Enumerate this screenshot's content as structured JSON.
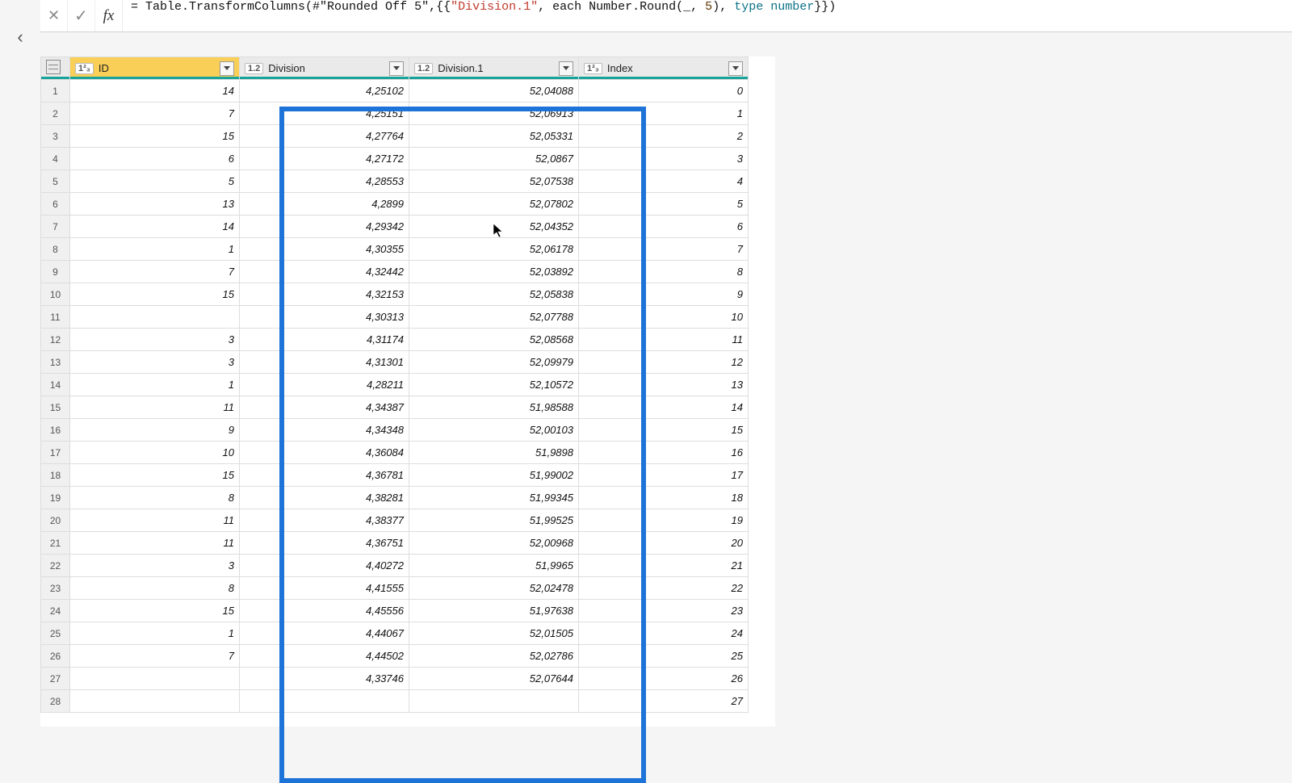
{
  "formula": {
    "prefix": "= Table.TransformColumns(#",
    "step_ref": "\"Rounded Off 5\"",
    "mid1": ",{{",
    "col_ref": "\"Division.1\"",
    "mid2": ", each Number.Round(_, ",
    "round_n": "5",
    "mid3": "), ",
    "type_kw": "type number",
    "suffix": "}})"
  },
  "columns": {
    "id": {
      "type": "1²₃",
      "label": "ID"
    },
    "div": {
      "type": "1.2",
      "label": "Division"
    },
    "div1": {
      "type": "1.2",
      "label": "Division.1"
    },
    "idx": {
      "type": "1²₃",
      "label": "Index"
    }
  },
  "rows": [
    {
      "n": "1",
      "id": "14",
      "div": "4,25102",
      "div1": "52,04088",
      "idx": "0"
    },
    {
      "n": "2",
      "id": "7",
      "div": "4,25151",
      "div1": "52,06913",
      "idx": "1"
    },
    {
      "n": "3",
      "id": "15",
      "div": "4,27764",
      "div1": "52,05331",
      "idx": "2"
    },
    {
      "n": "4",
      "id": "6",
      "div": "4,27172",
      "div1": "52,0867",
      "idx": "3"
    },
    {
      "n": "5",
      "id": "5",
      "div": "4,28553",
      "div1": "52,07538",
      "idx": "4"
    },
    {
      "n": "6",
      "id": "13",
      "div": "4,2899",
      "div1": "52,07802",
      "idx": "5"
    },
    {
      "n": "7",
      "id": "14",
      "div": "4,29342",
      "div1": "52,04352",
      "idx": "6"
    },
    {
      "n": "8",
      "id": "1",
      "div": "4,30355",
      "div1": "52,06178",
      "idx": "7"
    },
    {
      "n": "9",
      "id": "7",
      "div": "4,32442",
      "div1": "52,03892",
      "idx": "8"
    },
    {
      "n": "10",
      "id": "15",
      "div": "4,32153",
      "div1": "52,05838",
      "idx": "9"
    },
    {
      "n": "11",
      "id": "",
      "div": "4,30313",
      "div1": "52,07788",
      "idx": "10"
    },
    {
      "n": "12",
      "id": "3",
      "div": "4,31174",
      "div1": "52,08568",
      "idx": "11"
    },
    {
      "n": "13",
      "id": "3",
      "div": "4,31301",
      "div1": "52,09979",
      "idx": "12"
    },
    {
      "n": "14",
      "id": "1",
      "div": "4,28211",
      "div1": "52,10572",
      "idx": "13"
    },
    {
      "n": "15",
      "id": "11",
      "div": "4,34387",
      "div1": "51,98588",
      "idx": "14"
    },
    {
      "n": "16",
      "id": "9",
      "div": "4,34348",
      "div1": "52,00103",
      "idx": "15"
    },
    {
      "n": "17",
      "id": "10",
      "div": "4,36084",
      "div1": "51,9898",
      "idx": "16"
    },
    {
      "n": "18",
      "id": "15",
      "div": "4,36781",
      "div1": "51,99002",
      "idx": "17"
    },
    {
      "n": "19",
      "id": "8",
      "div": "4,38281",
      "div1": "51,99345",
      "idx": "18"
    },
    {
      "n": "20",
      "id": "11",
      "div": "4,38377",
      "div1": "51,99525",
      "idx": "19"
    },
    {
      "n": "21",
      "id": "11",
      "div": "4,36751",
      "div1": "52,00968",
      "idx": "20"
    },
    {
      "n": "22",
      "id": "3",
      "div": "4,40272",
      "div1": "51,9965",
      "idx": "21"
    },
    {
      "n": "23",
      "id": "8",
      "div": "4,41555",
      "div1": "52,02478",
      "idx": "22"
    },
    {
      "n": "24",
      "id": "15",
      "div": "4,45556",
      "div1": "51,97638",
      "idx": "23"
    },
    {
      "n": "25",
      "id": "1",
      "div": "4,44067",
      "div1": "52,01505",
      "idx": "24"
    },
    {
      "n": "26",
      "id": "7",
      "div": "4,44502",
      "div1": "52,02786",
      "idx": "25"
    },
    {
      "n": "27",
      "id": "",
      "div": "4,33746",
      "div1": "52,07644",
      "idx": "26"
    },
    {
      "n": "28",
      "id": "",
      "div": "",
      "div1": "",
      "idx": "27"
    }
  ]
}
